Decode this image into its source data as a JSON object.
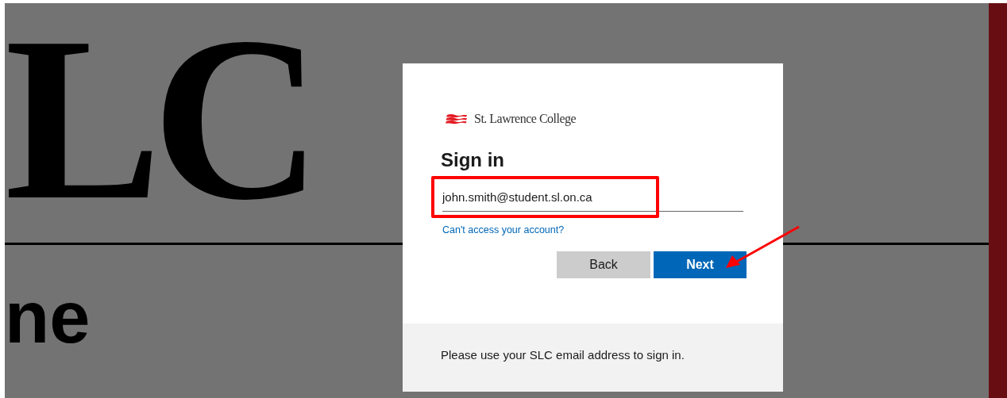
{
  "background": {
    "logo_fragment": "LC",
    "heading_fragment": "ne"
  },
  "dialog": {
    "logo_text": "St. Lawrence College",
    "title": "Sign in",
    "email_field": {
      "value": "john.smith@student.sl.on.ca"
    },
    "help_link": "Can't access your account?",
    "buttons": [
      {
        "label": "Back",
        "kind": "secondary"
      },
      {
        "label": "Next",
        "kind": "primary"
      }
    ],
    "footer_text": "Please use your SLC email address to sign in."
  }
}
